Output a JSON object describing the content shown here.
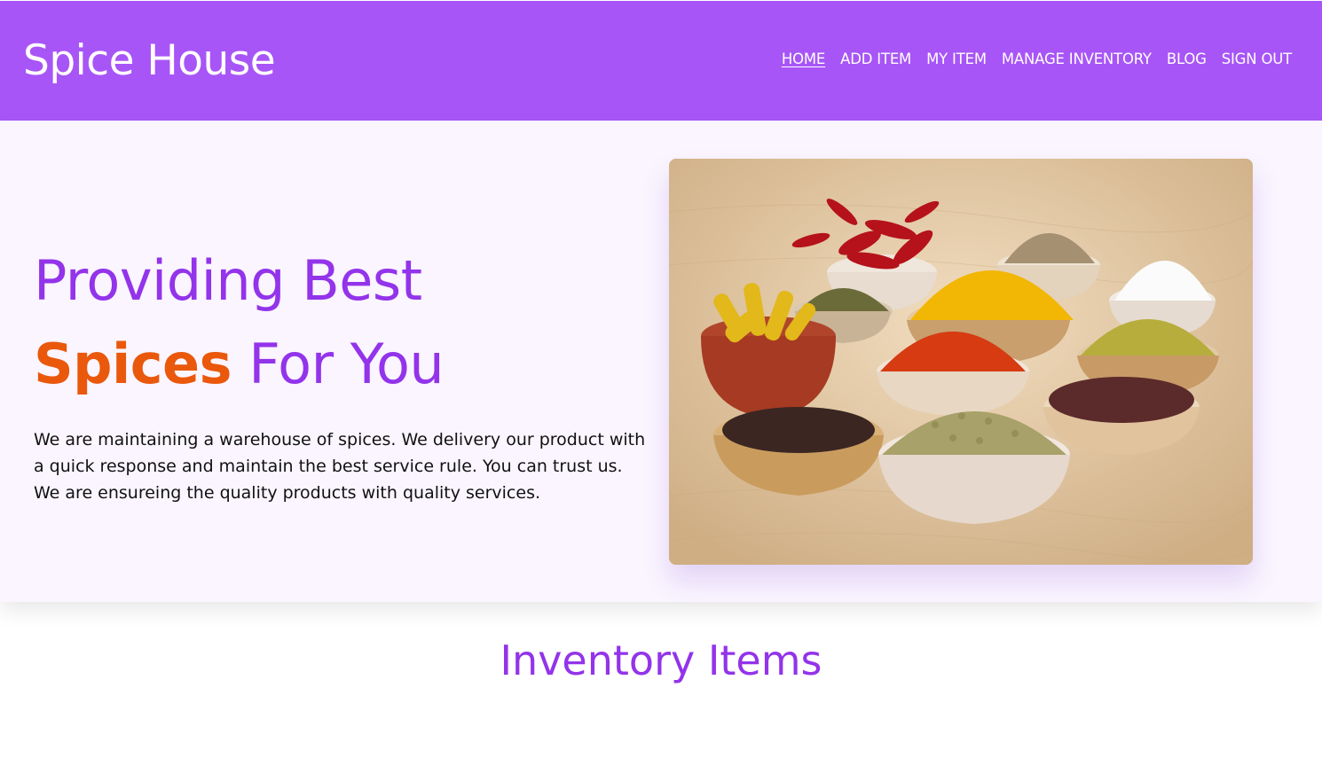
{
  "header": {
    "brand": "Spice House",
    "nav": [
      "HOME",
      "ADD ITEM",
      "MY ITEM",
      "MANAGE INVENTORY",
      "BLOG",
      "SIGN OUT"
    ],
    "active": "HOME"
  },
  "hero": {
    "line1": "Providing Best",
    "line2_accent": "Spices",
    "line2_rest": "For You",
    "description": "We are maintaining a warehouse of spices. We delivery our product with a quick response and maintain the best service rule. You can trust us. We are ensureing the quality products with quality services."
  },
  "inventory": {
    "title": "Inventory Items"
  },
  "colors": {
    "header_bg": "#a855f7",
    "primary_text": "#9333ea",
    "accent": "#ea580c",
    "hero_bg": "#faf5ff"
  }
}
